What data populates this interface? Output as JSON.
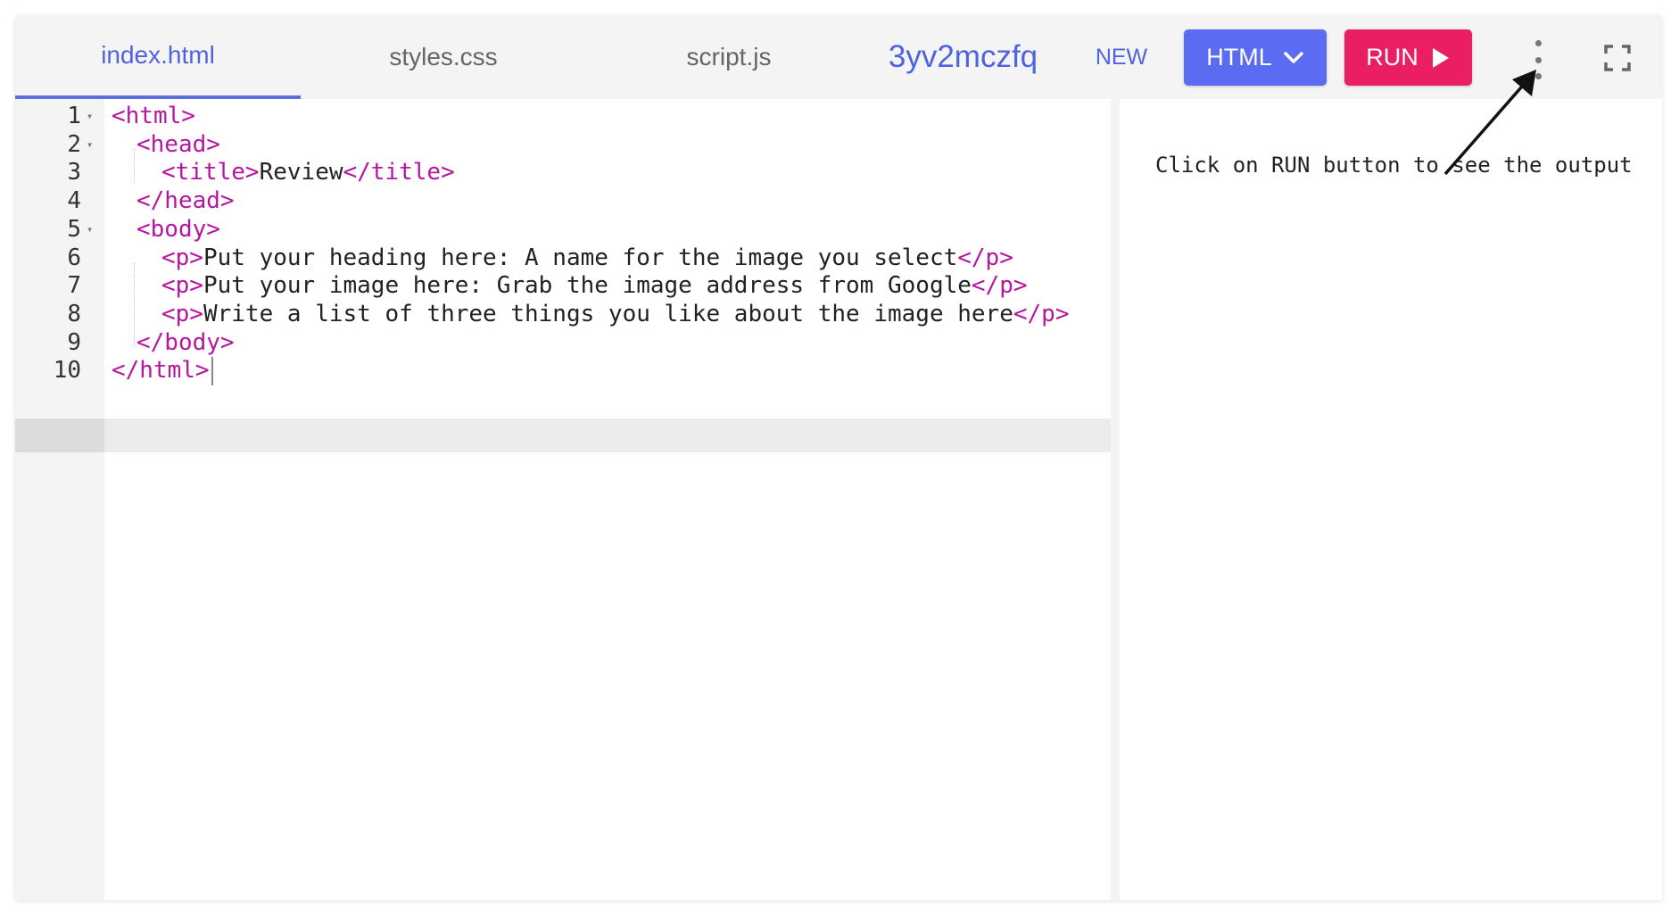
{
  "tabs": [
    {
      "label": "index.html",
      "active": true
    },
    {
      "label": "styles.css",
      "active": false
    },
    {
      "label": "script.js",
      "active": false
    }
  ],
  "project_name": "3yv2mczfq",
  "new_label": "NEW",
  "language_button": {
    "label": "HTML",
    "icon": "chevron-down-icon"
  },
  "run_button": {
    "label": "RUN",
    "icon": "play-icon"
  },
  "more_icon": "more-vertical-icon",
  "fullscreen_icon": "fullscreen-icon",
  "colors": {
    "accent": "#5b6cf2",
    "run": "#e91e63",
    "tag": "#b5179e"
  },
  "editor": {
    "active_line": 10,
    "lines": [
      {
        "num": "1",
        "fold": true,
        "parts": [
          [
            "tag",
            "<html>"
          ]
        ]
      },
      {
        "num": "2",
        "fold": true,
        "parts": [
          [
            "tag",
            "<head>"
          ]
        ]
      },
      {
        "num": "3",
        "fold": false,
        "parts": [
          [
            "tag",
            "<title>"
          ],
          [
            "text",
            "Review"
          ],
          [
            "tag",
            "</title>"
          ]
        ]
      },
      {
        "num": "4",
        "fold": false,
        "parts": [
          [
            "tag",
            "</head>"
          ]
        ]
      },
      {
        "num": "5",
        "fold": true,
        "parts": [
          [
            "tag",
            "<body>"
          ]
        ]
      },
      {
        "num": "6",
        "fold": false,
        "parts": [
          [
            "tag",
            "<p>"
          ],
          [
            "text",
            "Put your heading here: A name for the image you select"
          ],
          [
            "tag",
            "</p>"
          ]
        ]
      },
      {
        "num": "7",
        "fold": false,
        "parts": [
          [
            "tag",
            "<p>"
          ],
          [
            "text",
            "Put your image here: Grab the image address from Google"
          ],
          [
            "tag",
            "</p>"
          ]
        ]
      },
      {
        "num": "8",
        "fold": false,
        "parts": [
          [
            "tag",
            "<p>"
          ],
          [
            "text",
            "Write a list of three things you like about the image here"
          ],
          [
            "tag",
            "</p>"
          ]
        ]
      },
      {
        "num": "9",
        "fold": false,
        "parts": [
          [
            "tag",
            "</body>"
          ]
        ]
      },
      {
        "num": "10",
        "fold": false,
        "parts": [
          [
            "tag",
            "</html>"
          ]
        ]
      }
    ]
  },
  "output": {
    "message": "Click on RUN button to see the output"
  }
}
